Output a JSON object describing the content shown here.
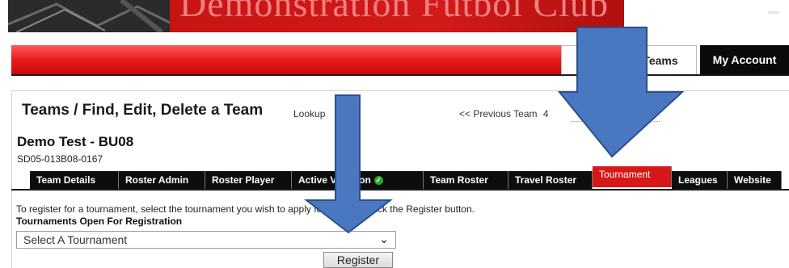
{
  "banner": {
    "club_name": "Demonstration Futbol Club"
  },
  "nav": {
    "teams_label": "Teams",
    "my_account_label": "My Account"
  },
  "page": {
    "title": "Teams / Find, Edit, Delete a Team",
    "lookup_label": "Lookup",
    "previous_team_label": "<< Previous Team",
    "previous_team_number": "4"
  },
  "team": {
    "name": "Demo Test - BU08",
    "code": "SD05-013B08-0167"
  },
  "tabs": [
    {
      "label": "Team Details",
      "active": false
    },
    {
      "label": "Roster Admin",
      "active": false
    },
    {
      "label": "Roster Player",
      "active": false
    },
    {
      "label": "Active Violation",
      "active": false
    },
    {
      "label": "Team Roster",
      "active": false
    },
    {
      "label": "Travel Roster",
      "active": false
    },
    {
      "label": "Tournament",
      "active": true
    },
    {
      "label": "Leagues",
      "active": false
    },
    {
      "label": "Website",
      "active": false
    }
  ],
  "tournament": {
    "instructions": "To register for a tournament, select the tournament you wish to apply for and then click the Register button.",
    "open_label": "Tournaments Open For Registration",
    "select_value": "Select A Tournament",
    "register_label": "Register"
  },
  "colors": {
    "brand_red": "#d81818",
    "nav_black": "#0a0a0a",
    "arrow_blue": "#4a78c0"
  }
}
